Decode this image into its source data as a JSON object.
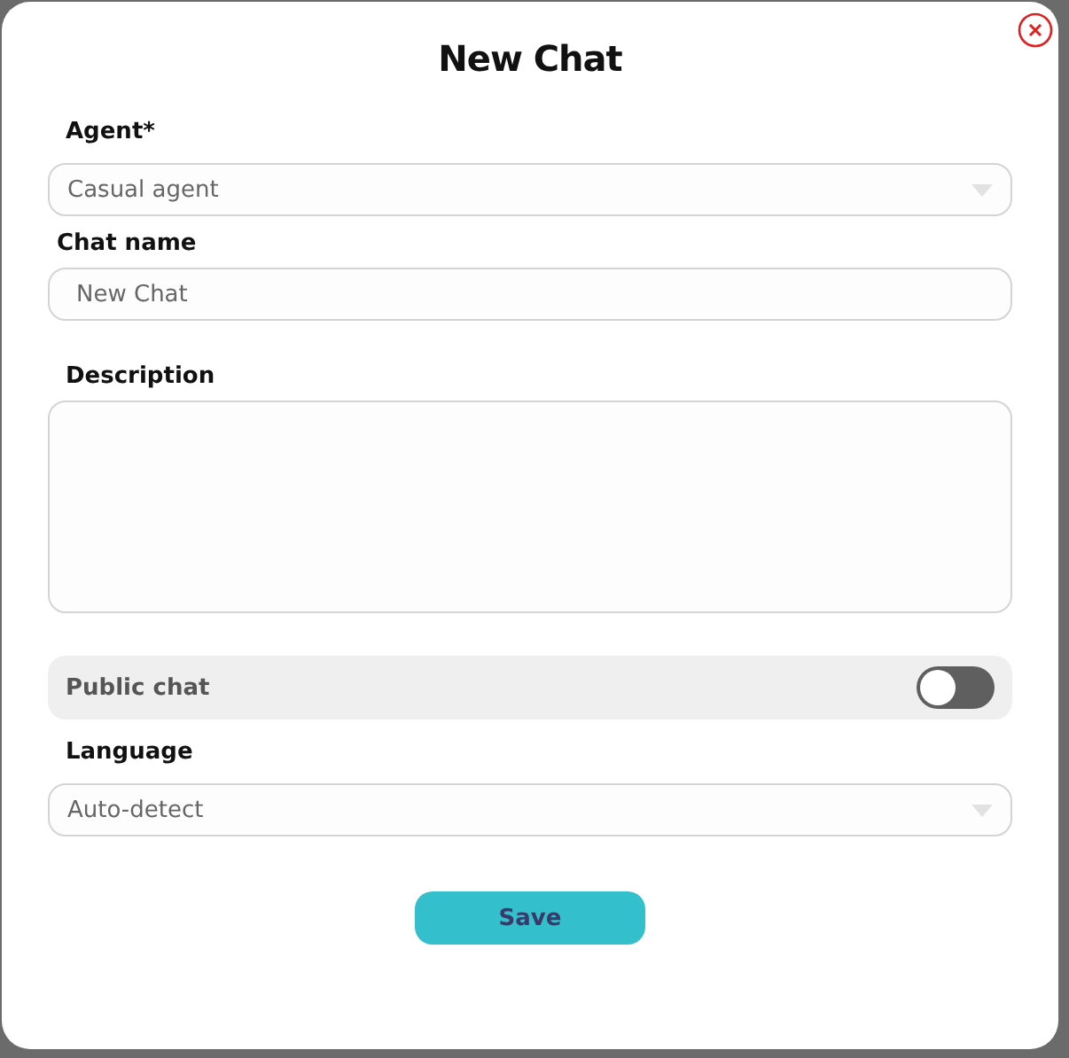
{
  "dialog": {
    "title": "New Chat"
  },
  "fields": [
    {
      "kind": "select",
      "label": "Agent*",
      "value": "Casual agent"
    },
    {
      "kind": "text",
      "label": "Chat name",
      "value": "New Chat"
    },
    {
      "kind": "textarea",
      "label": "Description"
    },
    {
      "kind": "toggle",
      "label": "Public chat",
      "on": false
    },
    {
      "kind": "select",
      "label": "Language",
      "value": "Auto-detect"
    }
  ],
  "buttons": [
    {
      "label": "Save"
    }
  ]
}
